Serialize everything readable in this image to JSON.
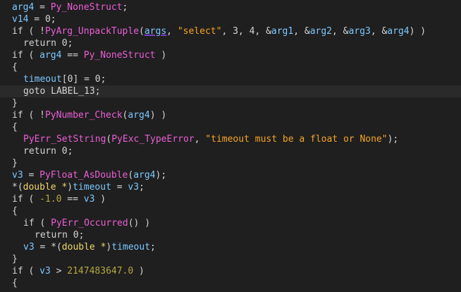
{
  "colors": {
    "background": "#1f1f1f",
    "highlight_line": "#2a2a2a",
    "variable": "#7cc8ff",
    "function": "#ea5fd6",
    "string": "#f5a623",
    "number": "#b5a642",
    "type": "#f0d66b",
    "plain": "#d4d4d4"
  },
  "lines": [
    {
      "indent": 0,
      "tokens": [
        {
          "t": "arg4",
          "c": "var"
        },
        {
          "t": " = ",
          "c": "op"
        },
        {
          "t": "Py_NoneStruct",
          "c": "func"
        },
        {
          "t": ";",
          "c": "op"
        }
      ]
    },
    {
      "indent": 0,
      "tokens": [
        {
          "t": "v14",
          "c": "var"
        },
        {
          "t": " = 0;",
          "c": "op"
        }
      ]
    },
    {
      "indent": 0,
      "tokens": [
        {
          "t": "if ( !",
          "c": "kw"
        },
        {
          "t": "PyArg_UnpackTuple",
          "c": "func"
        },
        {
          "t": "(",
          "c": "op"
        },
        {
          "t": "args",
          "c": "arg"
        },
        {
          "t": ", ",
          "c": "op"
        },
        {
          "t": "\"select\"",
          "c": "str"
        },
        {
          "t": ", 3, 4, &",
          "c": "op"
        },
        {
          "t": "arg1",
          "c": "var"
        },
        {
          "t": ", &",
          "c": "op"
        },
        {
          "t": "arg2",
          "c": "var"
        },
        {
          "t": ", &",
          "c": "op"
        },
        {
          "t": "arg3",
          "c": "var"
        },
        {
          "t": ", &",
          "c": "op"
        },
        {
          "t": "arg4",
          "c": "var"
        },
        {
          "t": ") )",
          "c": "op"
        }
      ]
    },
    {
      "indent": 1,
      "tokens": [
        {
          "t": "return 0;",
          "c": "kw"
        }
      ]
    },
    {
      "indent": 0,
      "tokens": [
        {
          "t": "if ( ",
          "c": "kw"
        },
        {
          "t": "arg4",
          "c": "var"
        },
        {
          "t": " == ",
          "c": "op"
        },
        {
          "t": "Py_NoneStruct",
          "c": "func"
        },
        {
          "t": " )",
          "c": "op"
        }
      ]
    },
    {
      "indent": 0,
      "tokens": [
        {
          "t": "{",
          "c": "op"
        }
      ]
    },
    {
      "indent": 1,
      "tokens": [
        {
          "t": "timeout",
          "c": "var"
        },
        {
          "t": "[0] = 0;",
          "c": "op"
        }
      ]
    },
    {
      "indent": 1,
      "highlight": true,
      "tokens": [
        {
          "t": "goto LABEL_13;",
          "c": "label"
        }
      ]
    },
    {
      "indent": 0,
      "tokens": [
        {
          "t": "}",
          "c": "op"
        }
      ]
    },
    {
      "indent": 0,
      "tokens": [
        {
          "t": "if ( !",
          "c": "kw"
        },
        {
          "t": "PyNumber_Check",
          "c": "func"
        },
        {
          "t": "(",
          "c": "op"
        },
        {
          "t": "arg4",
          "c": "var"
        },
        {
          "t": ") )",
          "c": "op"
        }
      ]
    },
    {
      "indent": 0,
      "tokens": [
        {
          "t": "{",
          "c": "op"
        }
      ]
    },
    {
      "indent": 1,
      "tokens": [
        {
          "t": "PyErr_SetString",
          "c": "func"
        },
        {
          "t": "(",
          "c": "op"
        },
        {
          "t": "PyExc_TypeError",
          "c": "func"
        },
        {
          "t": ", ",
          "c": "op"
        },
        {
          "t": "\"timeout must be a float or None\"",
          "c": "str"
        },
        {
          "t": ");",
          "c": "op"
        }
      ]
    },
    {
      "indent": 1,
      "tokens": [
        {
          "t": "return 0;",
          "c": "kw"
        }
      ]
    },
    {
      "indent": 0,
      "tokens": [
        {
          "t": "}",
          "c": "op"
        }
      ]
    },
    {
      "indent": 0,
      "tokens": [
        {
          "t": "v3",
          "c": "var"
        },
        {
          "t": " = ",
          "c": "op"
        },
        {
          "t": "PyFloat_AsDouble",
          "c": "func"
        },
        {
          "t": "(",
          "c": "op"
        },
        {
          "t": "arg4",
          "c": "var"
        },
        {
          "t": ");",
          "c": "op"
        }
      ]
    },
    {
      "indent": 0,
      "tokens": [
        {
          "t": "*(",
          "c": "op"
        },
        {
          "t": "double *",
          "c": "type"
        },
        {
          "t": ")",
          "c": "op"
        },
        {
          "t": "timeout",
          "c": "var"
        },
        {
          "t": " = ",
          "c": "op"
        },
        {
          "t": "v3",
          "c": "var"
        },
        {
          "t": ";",
          "c": "op"
        }
      ]
    },
    {
      "indent": 0,
      "tokens": [
        {
          "t": "if ( ",
          "c": "kw"
        },
        {
          "t": "-1.0",
          "c": "num"
        },
        {
          "t": " == ",
          "c": "op"
        },
        {
          "t": "v3",
          "c": "var"
        },
        {
          "t": " )",
          "c": "op"
        }
      ]
    },
    {
      "indent": 0,
      "tokens": [
        {
          "t": "{",
          "c": "op"
        }
      ]
    },
    {
      "indent": 1,
      "tokens": [
        {
          "t": "if ( ",
          "c": "kw"
        },
        {
          "t": "PyErr_Occurred",
          "c": "func"
        },
        {
          "t": "() )",
          "c": "op"
        }
      ]
    },
    {
      "indent": 2,
      "tokens": [
        {
          "t": "return 0;",
          "c": "kw"
        }
      ]
    },
    {
      "indent": 1,
      "tokens": [
        {
          "t": "v3",
          "c": "var"
        },
        {
          "t": " = *(",
          "c": "op"
        },
        {
          "t": "double *",
          "c": "type"
        },
        {
          "t": ")",
          "c": "op"
        },
        {
          "t": "timeout",
          "c": "var"
        },
        {
          "t": ";",
          "c": "op"
        }
      ]
    },
    {
      "indent": 0,
      "tokens": [
        {
          "t": "}",
          "c": "op"
        }
      ]
    },
    {
      "indent": 0,
      "tokens": [
        {
          "t": "if ( ",
          "c": "kw"
        },
        {
          "t": "v3",
          "c": "var"
        },
        {
          "t": " > ",
          "c": "op"
        },
        {
          "t": "2147483647.0",
          "c": "num"
        },
        {
          "t": " )",
          "c": "op"
        }
      ]
    },
    {
      "indent": 0,
      "tokens": [
        {
          "t": "{",
          "c": "op"
        }
      ]
    }
  ]
}
